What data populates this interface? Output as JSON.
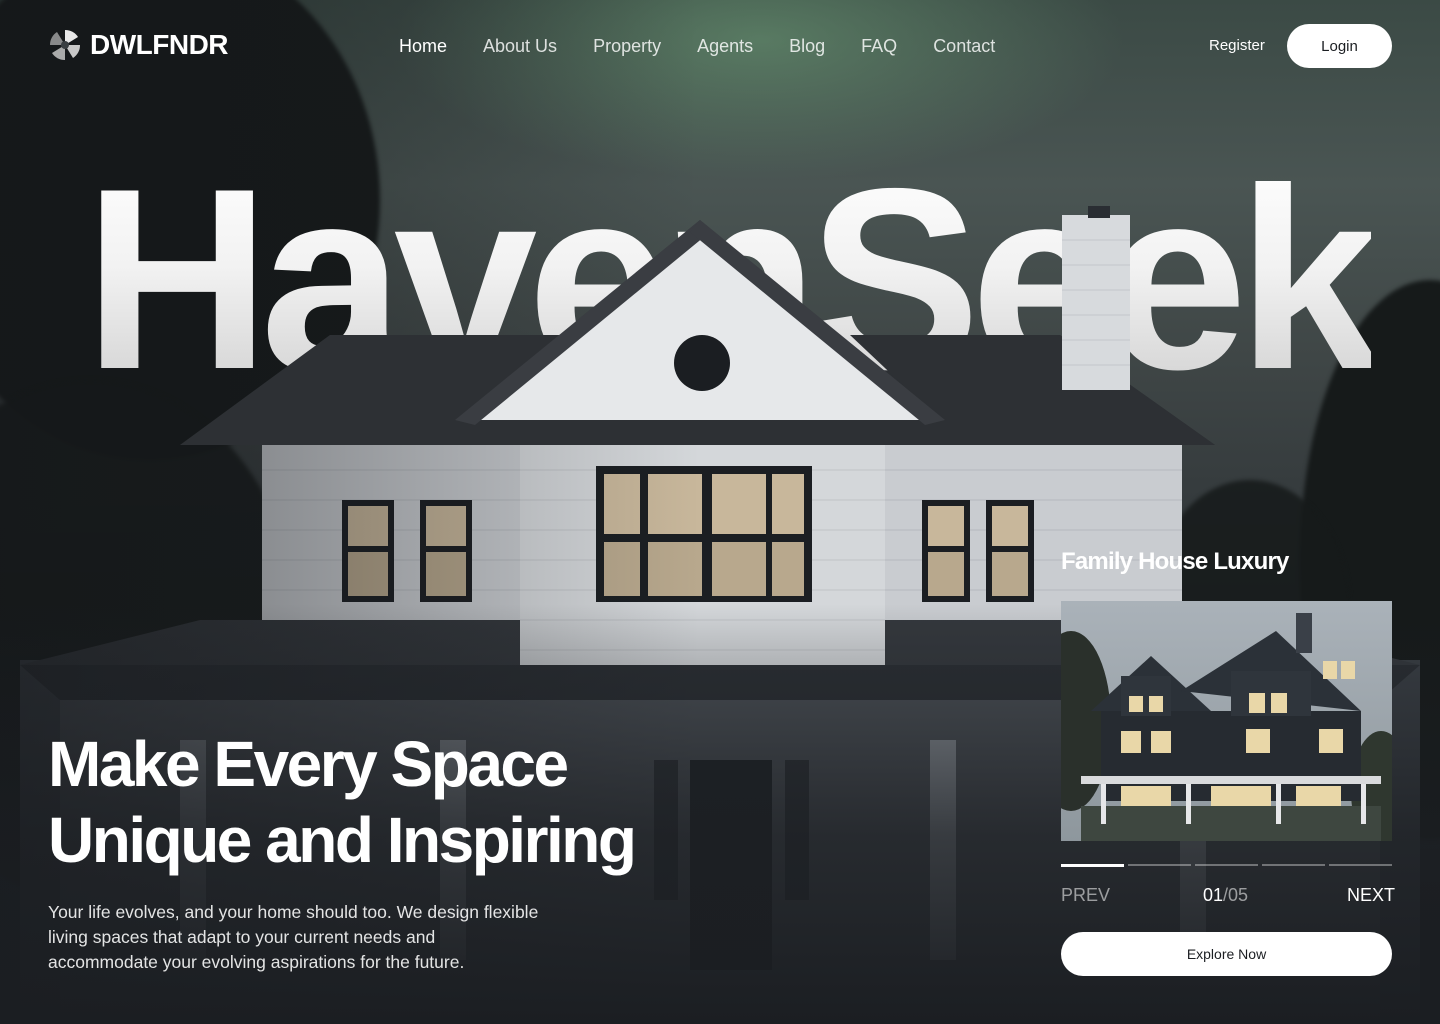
{
  "brand": {
    "name": "DWLFNDR",
    "logo_icon": "pinwheel-logo-icon"
  },
  "nav": {
    "items": [
      {
        "label": "Home",
        "active": true
      },
      {
        "label": "About Us"
      },
      {
        "label": "Property"
      },
      {
        "label": "Agents"
      },
      {
        "label": "Blog"
      },
      {
        "label": "FAQ"
      },
      {
        "label": "Contact"
      }
    ],
    "register_label": "Register",
    "login_label": "Login"
  },
  "hero": {
    "big_title": "HavenSeek",
    "headline_line1": "Make Every Space",
    "headline_line2": "Unique and Inspiring",
    "description": "Your life evolves, and your home should too. We design flexible living spaces that adapt to your current needs and accommodate your evolving aspirations for the future."
  },
  "card": {
    "title": "Family House Luxury",
    "prev_label": "PREV",
    "next_label": "NEXT",
    "current": "01",
    "separator": "/",
    "total": "05",
    "slide_count": 5,
    "active_slide": 1,
    "cta_label": "Explore Now"
  },
  "colors": {
    "background": "#1b1e22",
    "text": "#ffffff",
    "button_bg": "#ffffff",
    "button_text": "#1b1e22"
  }
}
